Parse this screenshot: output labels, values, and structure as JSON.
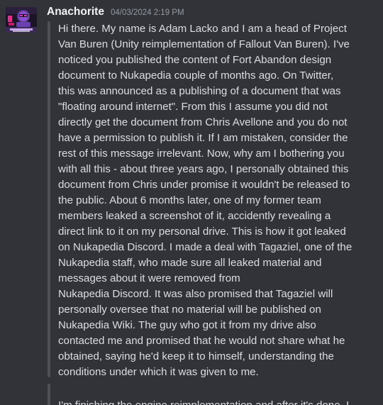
{
  "message": {
    "author": "Anachorite",
    "timestamp": "04/03/2024 2:19 PM",
    "paragraphs": [
      {
        "lines": [
          "Hi there.  My name is Adam Lacko and I am a head of Project",
          "Van Buren (Unity reimplementation of Fallout Van Buren). I've",
          "noticed you published the content of Fort Abandon design",
          "document to Nukapedia couple of months ago. On Twitter,",
          "this was announced as a publishing of a document that was",
          "\"floating around internet\". From this I assume you did not",
          "directly get the document from Chris Avellone and you do not",
          "have a permission to publish it. If I am mistaken, consider the",
          "rest of this message irrelevant.  Now, why am I bothering you",
          "with all this - about three years ago, I personally obtained this",
          "document from Chris under promise it wouldn't be released to",
          "the public. About 6 months later, one of my former team",
          "members leaked a screenshot of it, accidently revealing a",
          "direct link to it on my personal drive. This is how it got leaked",
          "on Nukapedia Discord. I made a deal with Tagaziel, one of the",
          "Nukapedia staff, who made sure all leaked material and",
          "messages about it were removed from",
          "Nukapedia Discord. It was also promised that Tagaziel will",
          "personally oversee that no material will be published on",
          "Nukapedia Wiki. The guy who got it from my drive also",
          "contacted me and promised that he would not share what he",
          "obtained, saying he'd keep it to himself, understanding the",
          "conditions under which it was given to me."
        ]
      },
      {
        "lines": [
          "I'm finishing the engine reimplementation and after it's done, I"
        ]
      }
    ]
  },
  "colors": {
    "background": "#313338",
    "username": "#f2f3f5",
    "timestamp": "#949ba4",
    "text": "#dbdee1",
    "quote_bar": "#4e5058"
  },
  "icons": {
    "avatar": "purple-robot-avatar-icon"
  }
}
